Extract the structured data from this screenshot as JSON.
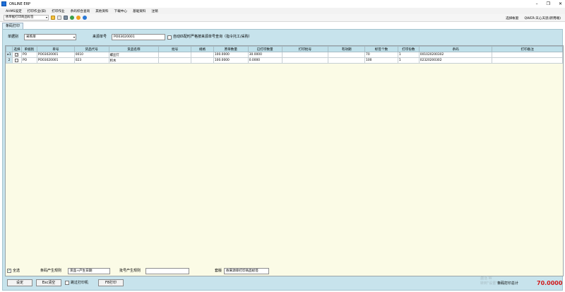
{
  "window": {
    "title": "ONLINE ERP",
    "controls": [
      "–",
      "❐",
      "✕"
    ]
  },
  "menu": [
    "AHMS设定",
    "打印作业(旧)",
    "打印作业",
    "条码综合查询",
    "其他资料",
    "下载中心",
    "基础资料",
    "注销"
  ],
  "toolbar": {
    "selector": "依单据打印商品标签",
    "right_items": [
      "选择帐套",
      "QWER-天心天思(新用端)"
    ]
  },
  "tab": {
    "label": "条码打印"
  },
  "filter": {
    "doc_type_label": "单据别",
    "doc_type_value": "采购单",
    "source_no_label": "来源单号",
    "source_no_value": "PO03020001",
    "auto_match_label": "自动匹配时严格按来源单号查询（指令托工/采购）"
  },
  "grid": {
    "columns": [
      "",
      "选择",
      "单据别",
      "单号",
      "货品代号",
      "货品名称",
      "批号",
      "规格",
      "原单数量",
      "已打印数量",
      "打印批号",
      "有效期",
      "标签个数",
      "打印份数",
      "条码",
      "打印备注"
    ],
    "rows": [
      {
        "n": "1",
        "arrow": "▸",
        "checked": "✓",
        "doc": "PO",
        "no": "PO03020001",
        "code": "0010",
        "name": "螺丝钉",
        "batch": "",
        "spec": "",
        "qty": "100.0000",
        "printed": "30.0000",
        "pbatch": "",
        "expiry": "",
        "labels": "70",
        "copies": "1",
        "barcode": "001020200302",
        "remark": ""
      },
      {
        "n": "2",
        "arrow": "",
        "checked": "",
        "doc": "PO",
        "no": "PO03020001",
        "code": "023",
        "name": "积木",
        "batch": "",
        "spec": "",
        "qty": "100.0000",
        "printed": "0.0000",
        "pbatch": "",
        "expiry": "",
        "labels": "100",
        "copies": "1",
        "barcode": "02320200302",
        "remark": ""
      }
    ]
  },
  "bottom": {
    "select_all_label": "全选",
    "select_all_checked": "✓",
    "barcode_rule_label": "条码产生规则",
    "barcode_rule_value": "货品+产生日期",
    "batch_rule_label": "批号产生规则",
    "batch_rule_value": "",
    "template_label": "套版",
    "template_value": "依来源单打印商品标签",
    "settings_button": "设定",
    "esc_button": "Esc清空",
    "preview_label": "跳过打印机",
    "print_button": "F8打印",
    "total_label": "条码打印总计",
    "total_value": "70.0000",
    "watermark_line1": "激活 W",
    "watermark_line2": "转到\"设置\"以激活"
  }
}
